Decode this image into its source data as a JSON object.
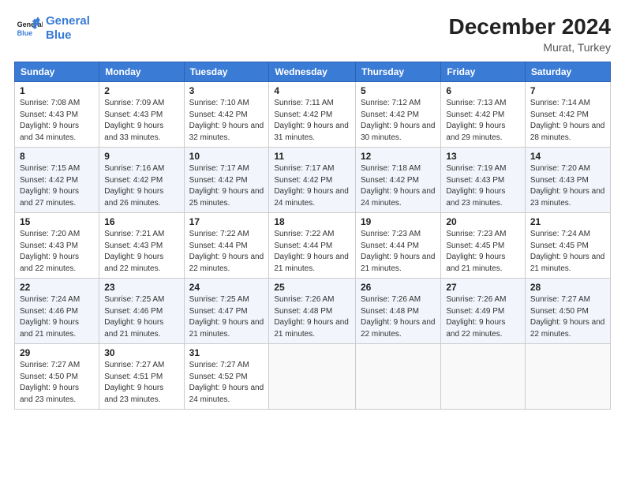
{
  "header": {
    "logo_line1": "General",
    "logo_line2": "Blue",
    "main_title": "December 2024",
    "subtitle": "Murat, Turkey"
  },
  "days_of_week": [
    "Sunday",
    "Monday",
    "Tuesday",
    "Wednesday",
    "Thursday",
    "Friday",
    "Saturday"
  ],
  "weeks": [
    [
      {
        "day": "1",
        "sunrise": "7:08 AM",
        "sunset": "4:43 PM",
        "daylight": "9 hours and 34 minutes."
      },
      {
        "day": "2",
        "sunrise": "7:09 AM",
        "sunset": "4:43 PM",
        "daylight": "9 hours and 33 minutes."
      },
      {
        "day": "3",
        "sunrise": "7:10 AM",
        "sunset": "4:42 PM",
        "daylight": "9 hours and 32 minutes."
      },
      {
        "day": "4",
        "sunrise": "7:11 AM",
        "sunset": "4:42 PM",
        "daylight": "9 hours and 31 minutes."
      },
      {
        "day": "5",
        "sunrise": "7:12 AM",
        "sunset": "4:42 PM",
        "daylight": "9 hours and 30 minutes."
      },
      {
        "day": "6",
        "sunrise": "7:13 AM",
        "sunset": "4:42 PM",
        "daylight": "9 hours and 29 minutes."
      },
      {
        "day": "7",
        "sunrise": "7:14 AM",
        "sunset": "4:42 PM",
        "daylight": "9 hours and 28 minutes."
      }
    ],
    [
      {
        "day": "8",
        "sunrise": "7:15 AM",
        "sunset": "4:42 PM",
        "daylight": "9 hours and 27 minutes."
      },
      {
        "day": "9",
        "sunrise": "7:16 AM",
        "sunset": "4:42 PM",
        "daylight": "9 hours and 26 minutes."
      },
      {
        "day": "10",
        "sunrise": "7:17 AM",
        "sunset": "4:42 PM",
        "daylight": "9 hours and 25 minutes."
      },
      {
        "day": "11",
        "sunrise": "7:17 AM",
        "sunset": "4:42 PM",
        "daylight": "9 hours and 24 minutes."
      },
      {
        "day": "12",
        "sunrise": "7:18 AM",
        "sunset": "4:42 PM",
        "daylight": "9 hours and 24 minutes."
      },
      {
        "day": "13",
        "sunrise": "7:19 AM",
        "sunset": "4:43 PM",
        "daylight": "9 hours and 23 minutes."
      },
      {
        "day": "14",
        "sunrise": "7:20 AM",
        "sunset": "4:43 PM",
        "daylight": "9 hours and 23 minutes."
      }
    ],
    [
      {
        "day": "15",
        "sunrise": "7:20 AM",
        "sunset": "4:43 PM",
        "daylight": "9 hours and 22 minutes."
      },
      {
        "day": "16",
        "sunrise": "7:21 AM",
        "sunset": "4:43 PM",
        "daylight": "9 hours and 22 minutes."
      },
      {
        "day": "17",
        "sunrise": "7:22 AM",
        "sunset": "4:44 PM",
        "daylight": "9 hours and 22 minutes."
      },
      {
        "day": "18",
        "sunrise": "7:22 AM",
        "sunset": "4:44 PM",
        "daylight": "9 hours and 21 minutes."
      },
      {
        "day": "19",
        "sunrise": "7:23 AM",
        "sunset": "4:44 PM",
        "daylight": "9 hours and 21 minutes."
      },
      {
        "day": "20",
        "sunrise": "7:23 AM",
        "sunset": "4:45 PM",
        "daylight": "9 hours and 21 minutes."
      },
      {
        "day": "21",
        "sunrise": "7:24 AM",
        "sunset": "4:45 PM",
        "daylight": "9 hours and 21 minutes."
      }
    ],
    [
      {
        "day": "22",
        "sunrise": "7:24 AM",
        "sunset": "4:46 PM",
        "daylight": "9 hours and 21 minutes."
      },
      {
        "day": "23",
        "sunrise": "7:25 AM",
        "sunset": "4:46 PM",
        "daylight": "9 hours and 21 minutes."
      },
      {
        "day": "24",
        "sunrise": "7:25 AM",
        "sunset": "4:47 PM",
        "daylight": "9 hours and 21 minutes."
      },
      {
        "day": "25",
        "sunrise": "7:26 AM",
        "sunset": "4:48 PM",
        "daylight": "9 hours and 21 minutes."
      },
      {
        "day": "26",
        "sunrise": "7:26 AM",
        "sunset": "4:48 PM",
        "daylight": "9 hours and 22 minutes."
      },
      {
        "day": "27",
        "sunrise": "7:26 AM",
        "sunset": "4:49 PM",
        "daylight": "9 hours and 22 minutes."
      },
      {
        "day": "28",
        "sunrise": "7:27 AM",
        "sunset": "4:50 PM",
        "daylight": "9 hours and 22 minutes."
      }
    ],
    [
      {
        "day": "29",
        "sunrise": "7:27 AM",
        "sunset": "4:50 PM",
        "daylight": "9 hours and 23 minutes."
      },
      {
        "day": "30",
        "sunrise": "7:27 AM",
        "sunset": "4:51 PM",
        "daylight": "9 hours and 23 minutes."
      },
      {
        "day": "31",
        "sunrise": "7:27 AM",
        "sunset": "4:52 PM",
        "daylight": "9 hours and 24 minutes."
      },
      null,
      null,
      null,
      null
    ]
  ]
}
